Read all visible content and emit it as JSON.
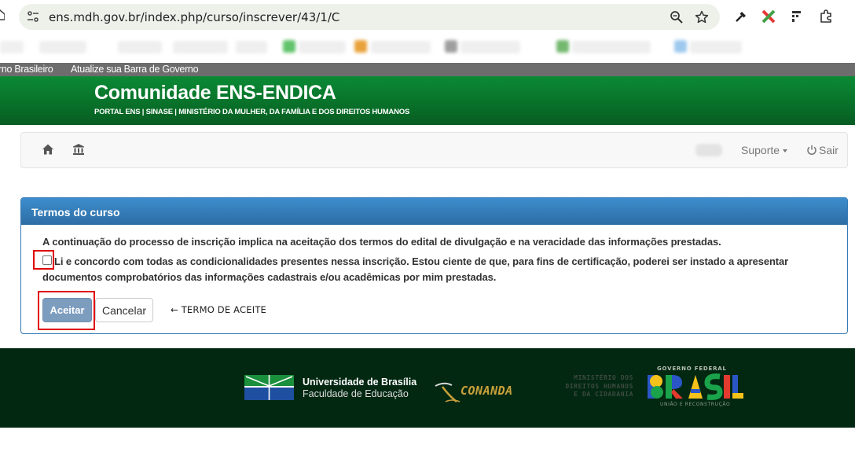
{
  "browser": {
    "url": "ens.mdh.gov.br/index.php/curso/inscrever/43/1/C"
  },
  "govbar": {
    "left_text": "rno Brasileiro",
    "update_text": "Atualize sua Barra de Governo"
  },
  "header": {
    "title": "Comunidade ENS-ENDICA",
    "subtitle": "PORTAL ENS | SINASE | MINISTÉRIO DA MULHER, DA FAMÍLIA E DOS DIREITOS HUMANOS"
  },
  "navbar": {
    "suporte": "Suporte",
    "sair": "Sair"
  },
  "panel": {
    "title": "Termos do curso",
    "intro": "A continuação do processo de inscrição implica na aceitação dos termos do edital de divulgação e na veracidade das informações prestadas.",
    "agree_line1": "Li e concordo com todas as condicionalidades presentes nessa inscrição. Estou ciente de que, para fins de certificação, poderei ser instado a apresentar",
    "agree_line2": "documentos comprobatórios das informações cadastrais e/ou acadêmicas por mim prestadas.",
    "accept_label": "Aceitar",
    "cancel_label": "Cancelar",
    "annotation": "← TERMO DE ACEITE"
  },
  "footer": {
    "unb_name": "Universidade de Brasília",
    "unb_faculty": "Faculdade de Educação",
    "conanda": "CONANDA",
    "mdh_line1": "MINISTÉRIO DOS",
    "mdh_line2": "DIREITOS HUMANOS",
    "mdh_line3": "E DA CIDADANIA",
    "gov_top": "GOVERNO FEDERAL",
    "gov_bottom": "UNIÃO E RECONSTRUÇÃO"
  },
  "colors": {
    "header_green": "#086b27",
    "panel_blue": "#337ab7",
    "footer_dark": "#022812",
    "highlight_red": "#e00000"
  }
}
